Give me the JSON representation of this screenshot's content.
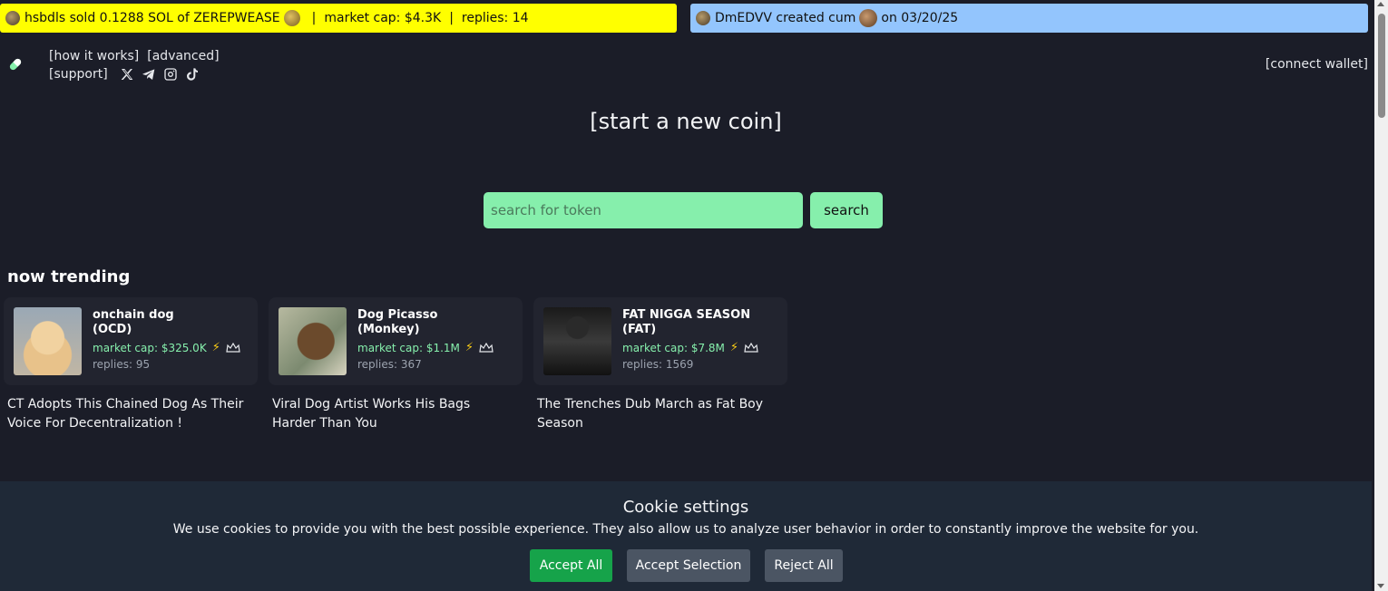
{
  "ticker_sell": {
    "text": "hsbdls sold 0.1288 SOL of ZEREPWEASE",
    "market_cap": "market cap: $4.3K",
    "separator": "|",
    "replies": "replies: 14",
    "background": "#ffff00"
  },
  "ticker_create": {
    "text": "DmEDVV created cum",
    "date": "on 03/20/25",
    "background": "#93c5fd"
  },
  "nav": {
    "how_it_works": "[how it works]",
    "advanced": "[advanced]",
    "support": "[support]",
    "social_icons": [
      "x-icon",
      "telegram-icon",
      "instagram-icon",
      "tiktok-icon"
    ]
  },
  "connect_wallet": "[connect wallet]",
  "start_coin": "[start a new coin]",
  "search": {
    "placeholder": "search for token",
    "button_label": "search"
  },
  "trending": {
    "title": "now trending",
    "cards": [
      {
        "name": "onchain dog",
        "ticker": "(OCD)",
        "market_cap": "market cap: $325.0K",
        "replies": "replies: 95",
        "headline": "CT Adopts This Chained Dog As Their Voice For Decentralization !"
      },
      {
        "name": "Dog Picasso",
        "ticker": "(Monkey)",
        "market_cap": "market cap: $1.1M",
        "replies": "replies: 367",
        "headline": "Viral Dog Artist Works His Bags Harder Than You"
      },
      {
        "name": "FAT NIGGA SEASON",
        "ticker": "(FAT)",
        "market_cap": "market cap: $7.8M",
        "replies": "replies: 1569",
        "headline": "The Trenches Dub March as Fat Boy Season"
      }
    ]
  },
  "cookie": {
    "title": "Cookie settings",
    "text": "We use cookies to provide you with the best possible experience. They also allow us to analyze user behavior in order to constantly improve the website for you.",
    "accept_all": "Accept All",
    "accept_selection": "Accept Selection",
    "reject_all": "Reject All"
  },
  "colors": {
    "background": "#1b1d28",
    "accent_green": "#86efac",
    "accept_green": "#16a34a"
  }
}
